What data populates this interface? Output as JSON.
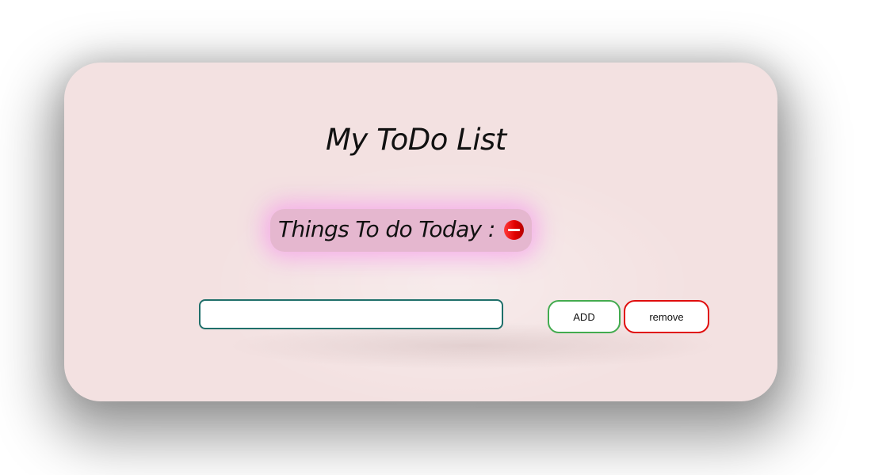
{
  "app": {
    "title": "My ToDo List"
  },
  "tasks": [
    {
      "label": "Things To do Today :",
      "remove_icon": "minus-circle-icon"
    }
  ],
  "form": {
    "input_value": "",
    "input_placeholder": "",
    "add_label": "ADD",
    "remove_label": "remove"
  },
  "colors": {
    "card_background": "#f3e1e1",
    "task_pill": "#e5b7cf",
    "task_glow": "#f582eb",
    "input_border": "#1f6f6a",
    "add_border": "#43ab4f",
    "remove_border": "#e00d0d",
    "remove_icon": "#e10000"
  }
}
